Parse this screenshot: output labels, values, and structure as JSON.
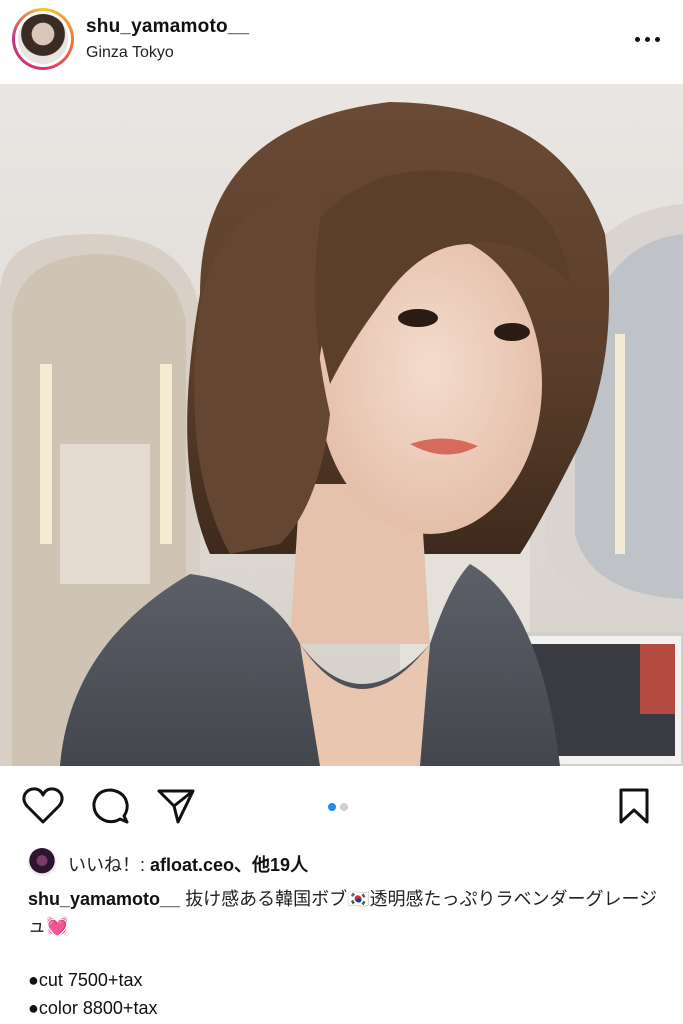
{
  "post": {
    "username": "shu_yamamoto__",
    "location": "Ginza Tokyo"
  },
  "icons": {
    "more": "more-horizontal-icon",
    "like": "heart-icon",
    "comment": "comment-bubble-icon",
    "share": "send-paper-plane-icon",
    "save": "bookmark-icon"
  },
  "carousel": {
    "current": 1,
    "total": 2,
    "active_color": "#1c8bea",
    "inactive_color": "#cfcfcf"
  },
  "likes": {
    "prefix": "いいね！: ",
    "liker": "afloat.ceo",
    "suffix": "、他19人"
  },
  "caption": {
    "username": "shu_yamamoto__",
    "text": " 抜け感ある韓国ボブ🇰🇷透明感たっぷりラベンダーグレージュ💓"
  },
  "menu_items": [
    {
      "label": "●cut  7500+tax"
    },
    {
      "label": "●color  8800+tax"
    }
  ]
}
